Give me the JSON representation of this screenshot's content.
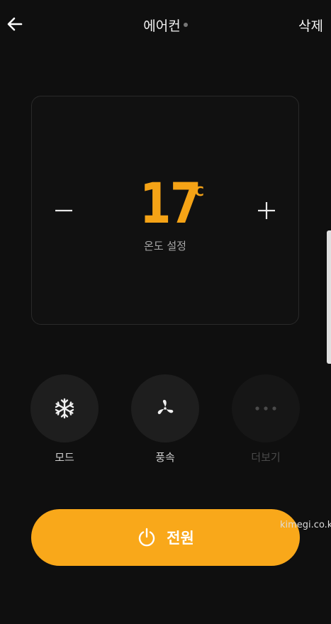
{
  "header": {
    "title": "에어컨",
    "delete_label": "삭제"
  },
  "temperature": {
    "value": "17",
    "unit": "℃",
    "label": "온도 설정"
  },
  "controls": [
    {
      "label": "모드",
      "icon": "snowflake-icon",
      "enabled": true
    },
    {
      "label": "풍속",
      "icon": "fan-icon",
      "enabled": true
    },
    {
      "label": "더보기",
      "icon": "more-icon",
      "enabled": false
    }
  ],
  "power": {
    "label": "전원",
    "icon": "power-icon"
  },
  "watermark": "kimegi.co.kr",
  "colors": {
    "accent": "#f5a316",
    "button": "#f9a81a",
    "background": "#0f0f0f"
  }
}
